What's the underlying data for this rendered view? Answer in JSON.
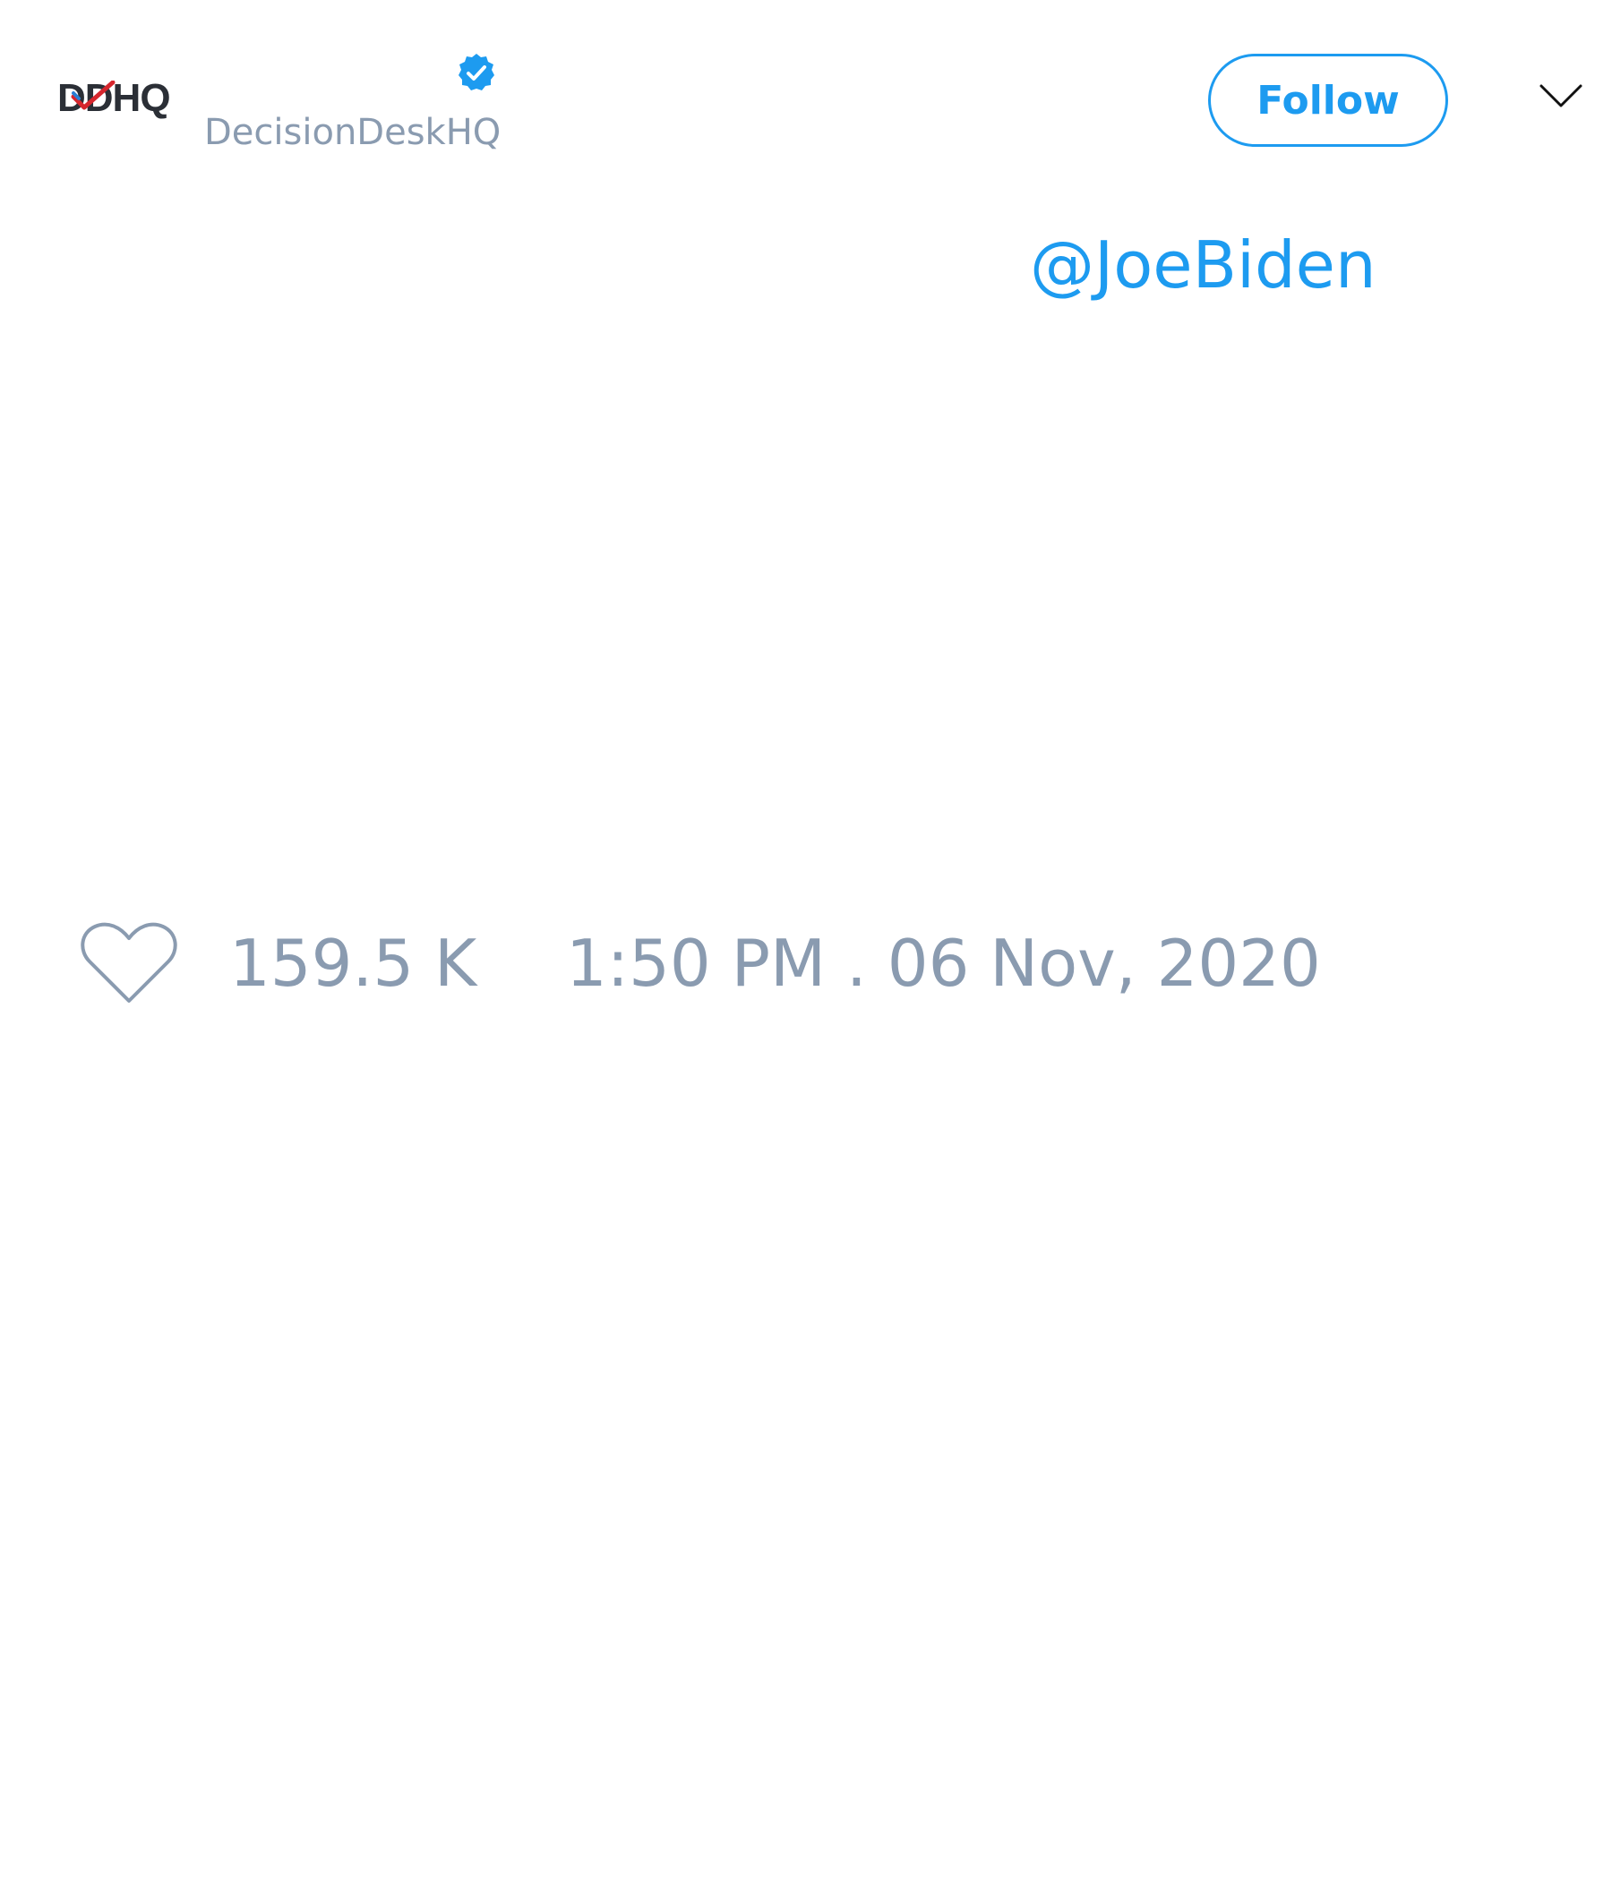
{
  "header": {
    "avatar_text": "DDHQ",
    "display_name": "",
    "handle": "DecisionDeskHQ",
    "verified": true,
    "follow_label": "Follow"
  },
  "tweet": {
    "mention": "@JoeBiden"
  },
  "footer": {
    "like_count": "159.5 K",
    "timestamp": "1:50 PM . 06 Nov, 2020"
  },
  "colors": {
    "accent": "#1d9bf0",
    "muted": "#8a9bb0",
    "background": "#ffffff"
  },
  "icons": {
    "verified": "verified-badge-icon",
    "menu": "chevron-down-icon",
    "like": "heart-icon"
  }
}
